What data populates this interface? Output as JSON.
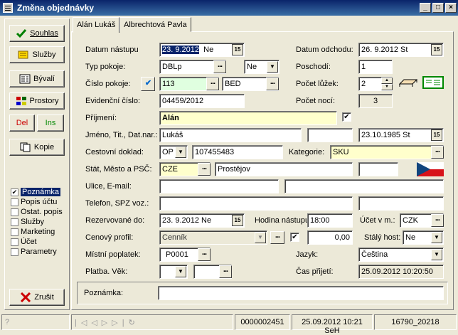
{
  "window": {
    "title": "Změna objednávky",
    "min": "_",
    "max": "□",
    "close": "×"
  },
  "sidebar": {
    "buttons": [
      {
        "key": "souhlas",
        "label": "Souhlas"
      },
      {
        "key": "sluzby",
        "label": "Služby"
      },
      {
        "key": "byvali",
        "label": "Bývalí"
      },
      {
        "key": "prostory",
        "label": "Prostory"
      },
      {
        "key": "kopie",
        "label": "Kopie"
      }
    ],
    "del": "Del",
    "ins": "Ins",
    "nav": [
      {
        "label": "Poznámka",
        "checked": true,
        "selected": true
      },
      {
        "label": "Popis účtu",
        "checked": false
      },
      {
        "label": "Ostat. popis",
        "checked": false
      },
      {
        "label": "Služby",
        "checked": false
      },
      {
        "label": "Marketing",
        "checked": false
      },
      {
        "label": "Účet",
        "checked": false
      },
      {
        "label": "Parametry",
        "checked": false
      }
    ],
    "cancel": "Zrušit"
  },
  "tabs": [
    "Alán Lukáš",
    "Albrechtová Pavla"
  ],
  "form": {
    "datum_nastupu_label": "Datum nástupu",
    "datum_nastupu_date": "23. 9.2012",
    "datum_nastupu_day": "Ne",
    "datum_odchodu_label": "Datum odchodu:",
    "datum_odchodu": "26. 9.2012  St",
    "typ_pokoje_label": "Typ pokoje:",
    "typ_pokoje": "DBLp",
    "typ_ne": "Ne",
    "poschodi_label": "Poschodí:",
    "poschodi": "1",
    "cislo_pokoje_label": "Číslo pokoje:",
    "cislo_pokoje": "113",
    "cislo_bed": "BED",
    "pocet_luzek_label": "Počet lůžek:",
    "pocet_luzek": "2",
    "evidencni_label": "Evidenční číslo:",
    "evidencni": "04459/2012",
    "pocet_noci_label": "Počet nocí:",
    "pocet_noci": "3",
    "prijmeni_label": "Příjmení:",
    "prijmeni": "Alán",
    "jmeno_label": "Jméno, Tit., Dat.nar.:",
    "jmeno": "Lukáš",
    "titul": "",
    "dat_nar": "23.10.1985  St",
    "doklad_label": "Cestovní doklad:",
    "doklad_typ": "OP",
    "doklad_cislo": "107455483",
    "kategorie_label": "Kategorie:",
    "kategorie": "SKU",
    "stat_label": "Stát, Město a PSČ:",
    "stat": "CZE",
    "mesto": "Prostějov",
    "psc": "",
    "ulice_label": "Ulice, E-mail:",
    "ulice": "",
    "email": "",
    "telefon_label": "Telefon, SPZ voz.:",
    "telefon": "",
    "spz": "",
    "rezervovane_label": "Rezervované do:",
    "rezervovane": "23. 9.2012  Ne",
    "hodina_label": "Hodina nástupu:",
    "hodina": "18:00",
    "ucet_label": "Účet v m.:",
    "mena": "CZK",
    "cenovy_label": "Cenový profil:",
    "cenovy": "Cenník",
    "cena": "0,00",
    "staly_label": "Stálý host:",
    "staly": "Ne",
    "mistni_label": "Místní poplatek:",
    "mistni": "P0001",
    "jazyk_label": "Jazyk:",
    "jazyk": "Čeština",
    "platba_label": "Platba. Věk:",
    "cas_label": "Čas přijetí:",
    "cas": "25.09.2012 10:20:50",
    "poznamka_label": "Poznámka:",
    "poznamka": ""
  },
  "statusbar": {
    "nav": [
      "|◁",
      "◁",
      "▷",
      "▷|",
      "↻"
    ],
    "id": "0000002451",
    "datetime": "25.09.2012 10:21 SeH",
    "code": "16790_20218"
  }
}
